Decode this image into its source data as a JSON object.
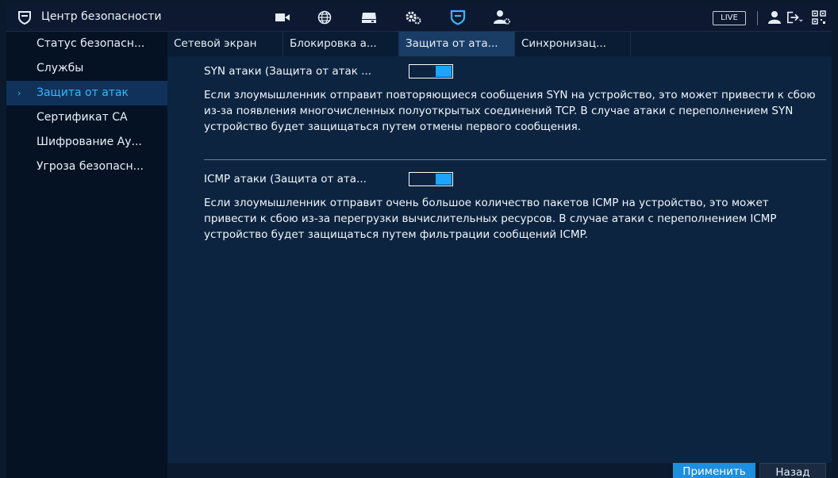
{
  "app": {
    "title": "Центр безопасности",
    "accent_color": "#1ca4ff"
  },
  "topbar": {
    "icons": [
      "camera-icon",
      "network-globe-icon",
      "storage-icon",
      "settings-gears-icon",
      "security-shield-icon",
      "account-settings-icon"
    ],
    "live_label": "LIVE",
    "right_icons": [
      "user-icon",
      "logout-icon",
      "qr-code-icon"
    ]
  },
  "sidebar": {
    "items": [
      {
        "label": "Статус безопасн..."
      },
      {
        "label": "Службы"
      },
      {
        "label": "Защита от атак"
      },
      {
        "label": "Сертификат CA"
      },
      {
        "label": "Шифрование Ау..."
      },
      {
        "label": "Угроза безопасн..."
      }
    ],
    "active_index": 2
  },
  "tabs": [
    {
      "label": "Сетевой экран"
    },
    {
      "label": "Блокировка а..."
    },
    {
      "label": "Защита от ата..."
    },
    {
      "label": "Синхронизац..."
    }
  ],
  "syn": {
    "label": "SYN атаки (Защита от атак ...",
    "enabled": true,
    "description": "Если злоумышленник отправит повторяющиеся сообщения SYN на устройство, это может привести к сбою из-за появления многочисленных полуоткрытых соединений TCP. В случае атаки с переполнением SYN устройство будет защищаться путем отмены первого сообщения."
  },
  "icmp": {
    "label": "ICMP атаки (Защита от ата...",
    "enabled": true,
    "description": "Если злоумышленник отправит очень большое количество пакетов ICMP на устройство, это может привести к сбою из-за перегрузки вычислительных ресурсов. В случае атаки с переполнением ICMP устройство будет защищаться путем фильтрации сообщений ICMP."
  },
  "buttons": {
    "apply": "Применить",
    "back": "Назад"
  }
}
